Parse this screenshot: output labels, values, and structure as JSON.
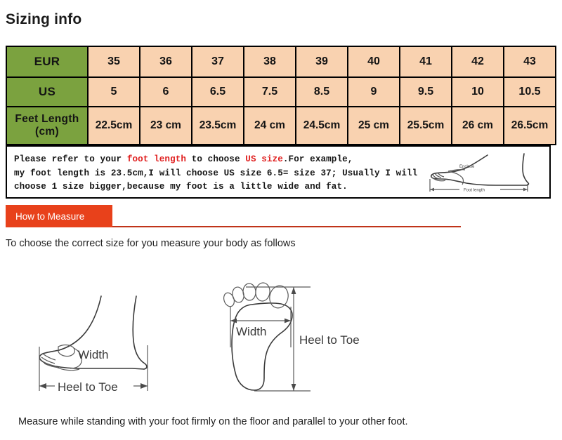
{
  "page_title": "Sizing info",
  "size_table": {
    "rows": [
      {
        "label": "EUR",
        "values": [
          "35",
          "36",
          "37",
          "38",
          "39",
          "40",
          "41",
          "42",
          "43"
        ]
      },
      {
        "label": "US",
        "values": [
          "5",
          "6",
          "6.5",
          "7.5",
          "8.5",
          "9",
          "9.5",
          "10",
          "10.5"
        ]
      },
      {
        "label": "Feet Length (cm)",
        "label_line1": "Feet Length",
        "label_line2": "(cm)",
        "values": [
          "22.5cm",
          "23 cm",
          "23.5cm",
          "24 cm",
          "24.5cm",
          "25 cm",
          "25.5cm",
          "26 cm",
          "26.5cm"
        ]
      }
    ]
  },
  "note": {
    "line1_a": "Please refer to your ",
    "line1_hl1": "foot length",
    "line1_b": " to choose ",
    "line1_hl2": "US size",
    "line1_c": ".For example,",
    "line2": "my foot length is 23.5cm,I will choose US size 6.5= size 37; Usually I will",
    "line3": "choose 1 size bigger,because my foot is a little wide and fat.",
    "diagram_labels": {
      "enclose": "Enclose",
      "foot_length": "Foot length"
    }
  },
  "howto": {
    "banner_label": "How to Measure",
    "subtitle": "To choose the correct size for you measure your body as follows",
    "side_diagram": {
      "width_label": "Width",
      "heel_to_toe_label": "Heel to Toe"
    },
    "sole_diagram": {
      "width_label": "Width",
      "heel_to_toe_label": "Heel to Toe"
    }
  },
  "bottom_caption": "Measure while standing with your foot firmly on the floor and parallel to your other foot.",
  "colors": {
    "table_label_green": "#7ba23f",
    "table_cell_peach": "#f9d2b0",
    "banner_orange": "#e8411b",
    "rule_red": "#c0341a",
    "highlight_red": "#e02020"
  }
}
